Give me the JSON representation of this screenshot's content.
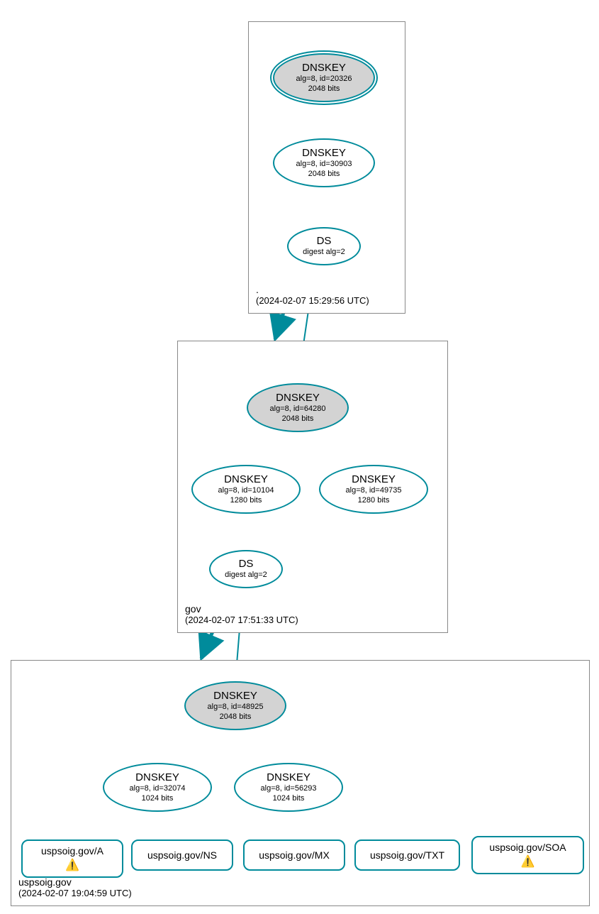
{
  "colors": {
    "stroke": "#008B9B",
    "ksk_fill": "#d3d3d3"
  },
  "zones": {
    "root": {
      "name": ".",
      "timestamp": "(2024-02-07 15:29:56 UTC)"
    },
    "gov": {
      "name": "gov",
      "timestamp": "(2024-02-07 17:51:33 UTC)"
    },
    "domain": {
      "name": "uspsoig.gov",
      "timestamp": "(2024-02-07 19:04:59 UTC)"
    }
  },
  "nodes": {
    "root_ksk": {
      "title": "DNSKEY",
      "sub1": "alg=8, id=20326",
      "sub2": "2048 bits"
    },
    "root_zsk": {
      "title": "DNSKEY",
      "sub1": "alg=8, id=30903",
      "sub2": "2048 bits"
    },
    "root_ds": {
      "title": "DS",
      "sub1": "digest alg=2"
    },
    "gov_ksk": {
      "title": "DNSKEY",
      "sub1": "alg=8, id=64280",
      "sub2": "2048 bits"
    },
    "gov_zsk1": {
      "title": "DNSKEY",
      "sub1": "alg=8, id=10104",
      "sub2": "1280 bits"
    },
    "gov_zsk2": {
      "title": "DNSKEY",
      "sub1": "alg=8, id=49735",
      "sub2": "1280 bits"
    },
    "gov_ds": {
      "title": "DS",
      "sub1": "digest alg=2"
    },
    "dom_ksk": {
      "title": "DNSKEY",
      "sub1": "alg=8, id=48925",
      "sub2": "2048 bits"
    },
    "dom_zsk1": {
      "title": "DNSKEY",
      "sub1": "alg=8, id=32074",
      "sub2": "1024 bits"
    },
    "dom_zsk2": {
      "title": "DNSKEY",
      "sub1": "alg=8, id=56293",
      "sub2": "1024 bits"
    },
    "rr_a": {
      "label": "uspsoig.gov/A",
      "warn": true
    },
    "rr_ns": {
      "label": "uspsoig.gov/NS",
      "warn": false
    },
    "rr_mx": {
      "label": "uspsoig.gov/MX",
      "warn": false
    },
    "rr_txt": {
      "label": "uspsoig.gov/TXT",
      "warn": false
    },
    "rr_soa": {
      "label": "uspsoig.gov/SOA",
      "warn": true
    }
  },
  "icons": {
    "warning": "⚠️"
  }
}
